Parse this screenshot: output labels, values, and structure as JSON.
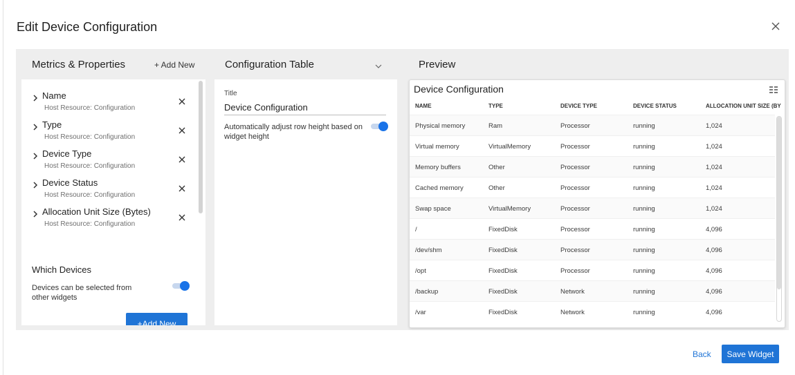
{
  "dialog": {
    "title": "Edit Device Configuration",
    "close_icon": "close-icon"
  },
  "metrics": {
    "heading": "Metrics & Properties",
    "add_new_link": "+ Add New",
    "items": [
      {
        "label": "Name",
        "source": "Host Resource: Configuration"
      },
      {
        "label": "Type",
        "source": "Host Resource: Configuration"
      },
      {
        "label": "Device Type",
        "source": "Host Resource: Configuration"
      },
      {
        "label": "Device Status",
        "source": "Host Resource: Configuration"
      },
      {
        "label": "Allocation Unit Size (Bytes)",
        "source": "Host Resource: Configuration"
      }
    ],
    "which_devices": {
      "title": "Which Devices",
      "toggle_label": "Devices can be selected from other widgets",
      "toggle_on": true
    },
    "add_new_button": "+Add New"
  },
  "config": {
    "heading": "Configuration Table",
    "title_label": "Title",
    "title_value": "Device Configuration",
    "row_height_label": "Automatically adjust row height based on widget height",
    "row_height_on": true
  },
  "preview": {
    "heading": "Preview",
    "widget_title": "Device Configuration",
    "columns": [
      "NAME",
      "TYPE",
      "DEVICE TYPE",
      "DEVICE STATUS",
      "ALLOCATION UNIT SIZE (BY"
    ],
    "rows": [
      [
        "Physical memory",
        "Ram",
        "Processor",
        "running",
        "1,024"
      ],
      [
        "Virtual memory",
        "VirtualMemory",
        "Processor",
        "running",
        "1,024"
      ],
      [
        "Memory buffers",
        "Other",
        "Processor",
        "running",
        "1,024"
      ],
      [
        "Cached memory",
        "Other",
        "Processor",
        "running",
        "1,024"
      ],
      [
        "Swap space",
        "VirtualMemory",
        "Processor",
        "running",
        "1,024"
      ],
      [
        "/",
        "FixedDisk",
        "Processor",
        "running",
        "4,096"
      ],
      [
        "/dev/shm",
        "FixedDisk",
        "Processor",
        "running",
        "4,096"
      ],
      [
        "/opt",
        "FixedDisk",
        "Processor",
        "running",
        "4,096"
      ],
      [
        "/backup",
        "FixedDisk",
        "Network",
        "running",
        "4,096"
      ],
      [
        "/var",
        "FixedDisk",
        "Network",
        "running",
        "4,096"
      ]
    ]
  },
  "footer": {
    "back": "Back",
    "save": "Save Widget"
  },
  "colors": {
    "accent": "#1f74d6",
    "workspace_bg": "#eeeeee"
  }
}
